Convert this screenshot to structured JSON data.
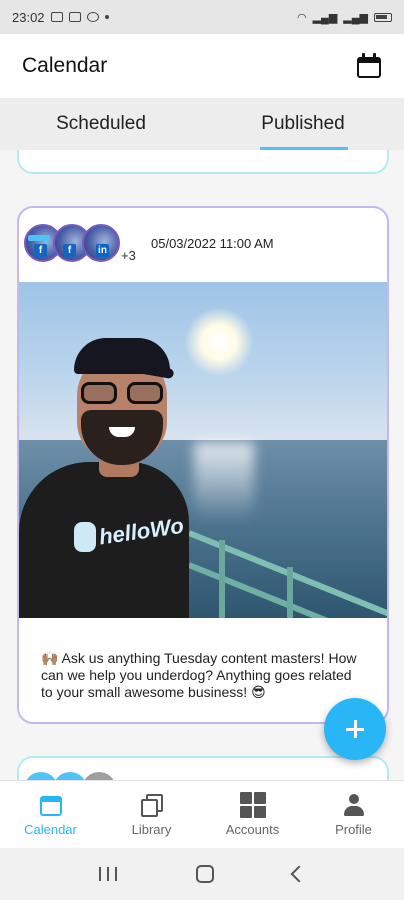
{
  "status_bar": {
    "time": "23:02"
  },
  "app_bar": {
    "title": "Calendar"
  },
  "tabs": [
    {
      "label": "Scheduled",
      "active": false
    },
    {
      "label": "Published",
      "active": true
    }
  ],
  "post": {
    "extra_accounts": "+3",
    "date": "05/03/2022 11:00 AM",
    "text": "🙌🏽 Ask us anything Tuesday content masters! How can we help you underdog? Anything goes related to your small awesome business! 😎",
    "shirt_text": "helloWo"
  },
  "bottom_nav": [
    {
      "label": "Calendar",
      "active": true
    },
    {
      "label": "Library",
      "active": false
    },
    {
      "label": "Accounts",
      "active": false
    },
    {
      "label": "Profile",
      "active": false
    }
  ],
  "colors": {
    "accent": "#29b6f6",
    "card_border": "#c5b8f0",
    "adjacent_card_border": "#b2ebf2"
  }
}
